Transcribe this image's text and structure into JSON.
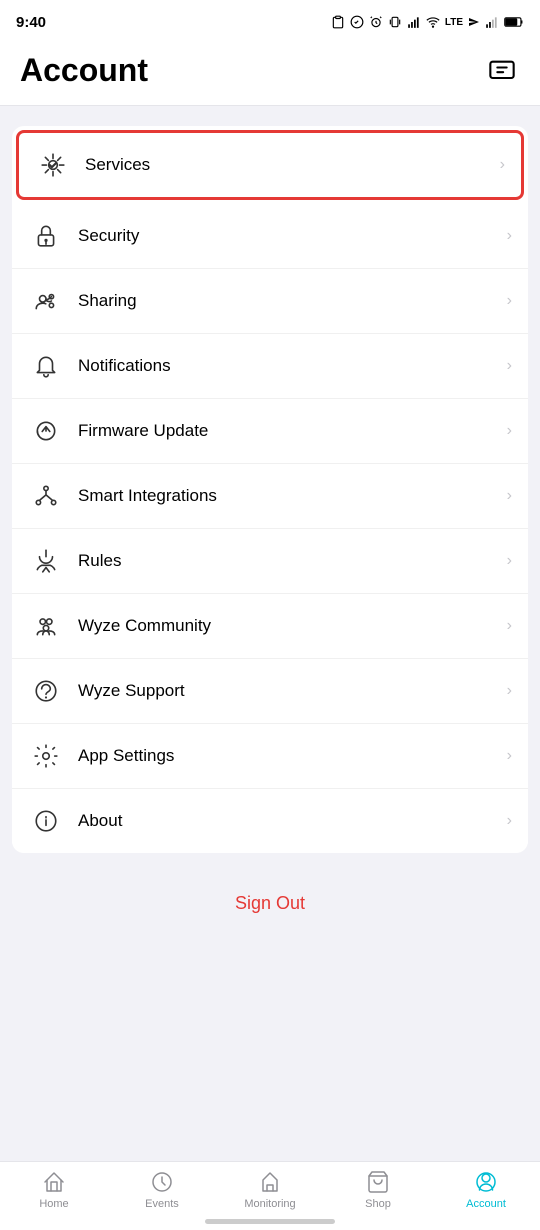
{
  "statusBar": {
    "time": "9:40",
    "icons": [
      "clipboard",
      "shazam",
      "alarm",
      "vibrate",
      "signal-alt",
      "wifi",
      "lte",
      "signal",
      "signal2",
      "battery"
    ]
  },
  "header": {
    "title": "Account",
    "messageIconLabel": "message-icon"
  },
  "menu": {
    "items": [
      {
        "id": "services",
        "label": "Services",
        "highlighted": true
      },
      {
        "id": "security",
        "label": "Security",
        "highlighted": false
      },
      {
        "id": "sharing",
        "label": "Sharing",
        "highlighted": false
      },
      {
        "id": "notifications",
        "label": "Notifications",
        "highlighted": false
      },
      {
        "id": "firmware-update",
        "label": "Firmware Update",
        "highlighted": false
      },
      {
        "id": "smart-integrations",
        "label": "Smart Integrations",
        "highlighted": false
      },
      {
        "id": "rules",
        "label": "Rules",
        "highlighted": false
      },
      {
        "id": "wyze-community",
        "label": "Wyze Community",
        "highlighted": false
      },
      {
        "id": "wyze-support",
        "label": "Wyze Support",
        "highlighted": false
      },
      {
        "id": "app-settings",
        "label": "App Settings",
        "highlighted": false
      },
      {
        "id": "about",
        "label": "About",
        "highlighted": false
      }
    ]
  },
  "signOut": {
    "label": "Sign Out"
  },
  "bottomNav": {
    "items": [
      {
        "id": "home",
        "label": "Home",
        "active": false
      },
      {
        "id": "events",
        "label": "Events",
        "active": false
      },
      {
        "id": "monitoring",
        "label": "Monitoring",
        "active": false
      },
      {
        "id": "shop",
        "label": "Shop",
        "active": false
      },
      {
        "id": "account",
        "label": "Account",
        "active": true
      }
    ]
  }
}
